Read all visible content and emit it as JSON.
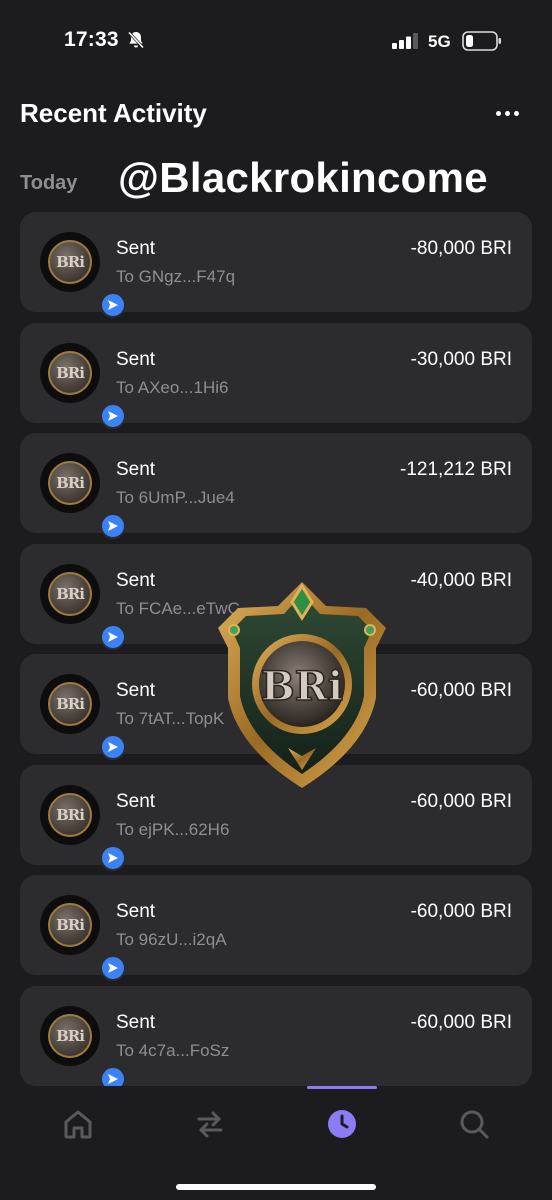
{
  "status_bar": {
    "time": "17:33",
    "network": "5G"
  },
  "header": {
    "title": "Recent Activity"
  },
  "section": {
    "label": "Today"
  },
  "watermark": "@Blackrokincome",
  "token_symbol_art": "BRi",
  "transactions": [
    {
      "type": "Sent",
      "recipient": "To GNgz...F47q",
      "amount": "-80,000 BRI"
    },
    {
      "type": "Sent",
      "recipient": "To AXeo...1Hi6",
      "amount": "-30,000 BRI"
    },
    {
      "type": "Sent",
      "recipient": "To 6UmP...Jue4",
      "amount": "-121,212 BRI"
    },
    {
      "type": "Sent",
      "recipient": "To FCAe...eTwC",
      "amount": "-40,000 BRI"
    },
    {
      "type": "Sent",
      "recipient": "To 7tAT...TopK",
      "amount": "-60,000 BRI"
    },
    {
      "type": "Sent",
      "recipient": "To ejPK...62H6",
      "amount": "-60,000 BRI"
    },
    {
      "type": "Sent",
      "recipient": "To 96zU...i2qA",
      "amount": "-60,000 BRI"
    },
    {
      "type": "Sent",
      "recipient": "To 4c7a...FoSz",
      "amount": "-60,000 BRI"
    }
  ],
  "tab_bar": {
    "tabs": [
      {
        "icon": "home-icon",
        "active": false
      },
      {
        "icon": "swap-icon",
        "active": false
      },
      {
        "icon": "clock-icon",
        "active": true
      },
      {
        "icon": "search-icon",
        "active": false
      }
    ],
    "active_color": "#8b7cf6",
    "inactive_color": "#5a5a5e"
  },
  "colors": {
    "background": "#1c1c1e",
    "card": "#2c2c2e",
    "secondary_text": "#8e8e93",
    "send_badge": "#3b82f6"
  }
}
